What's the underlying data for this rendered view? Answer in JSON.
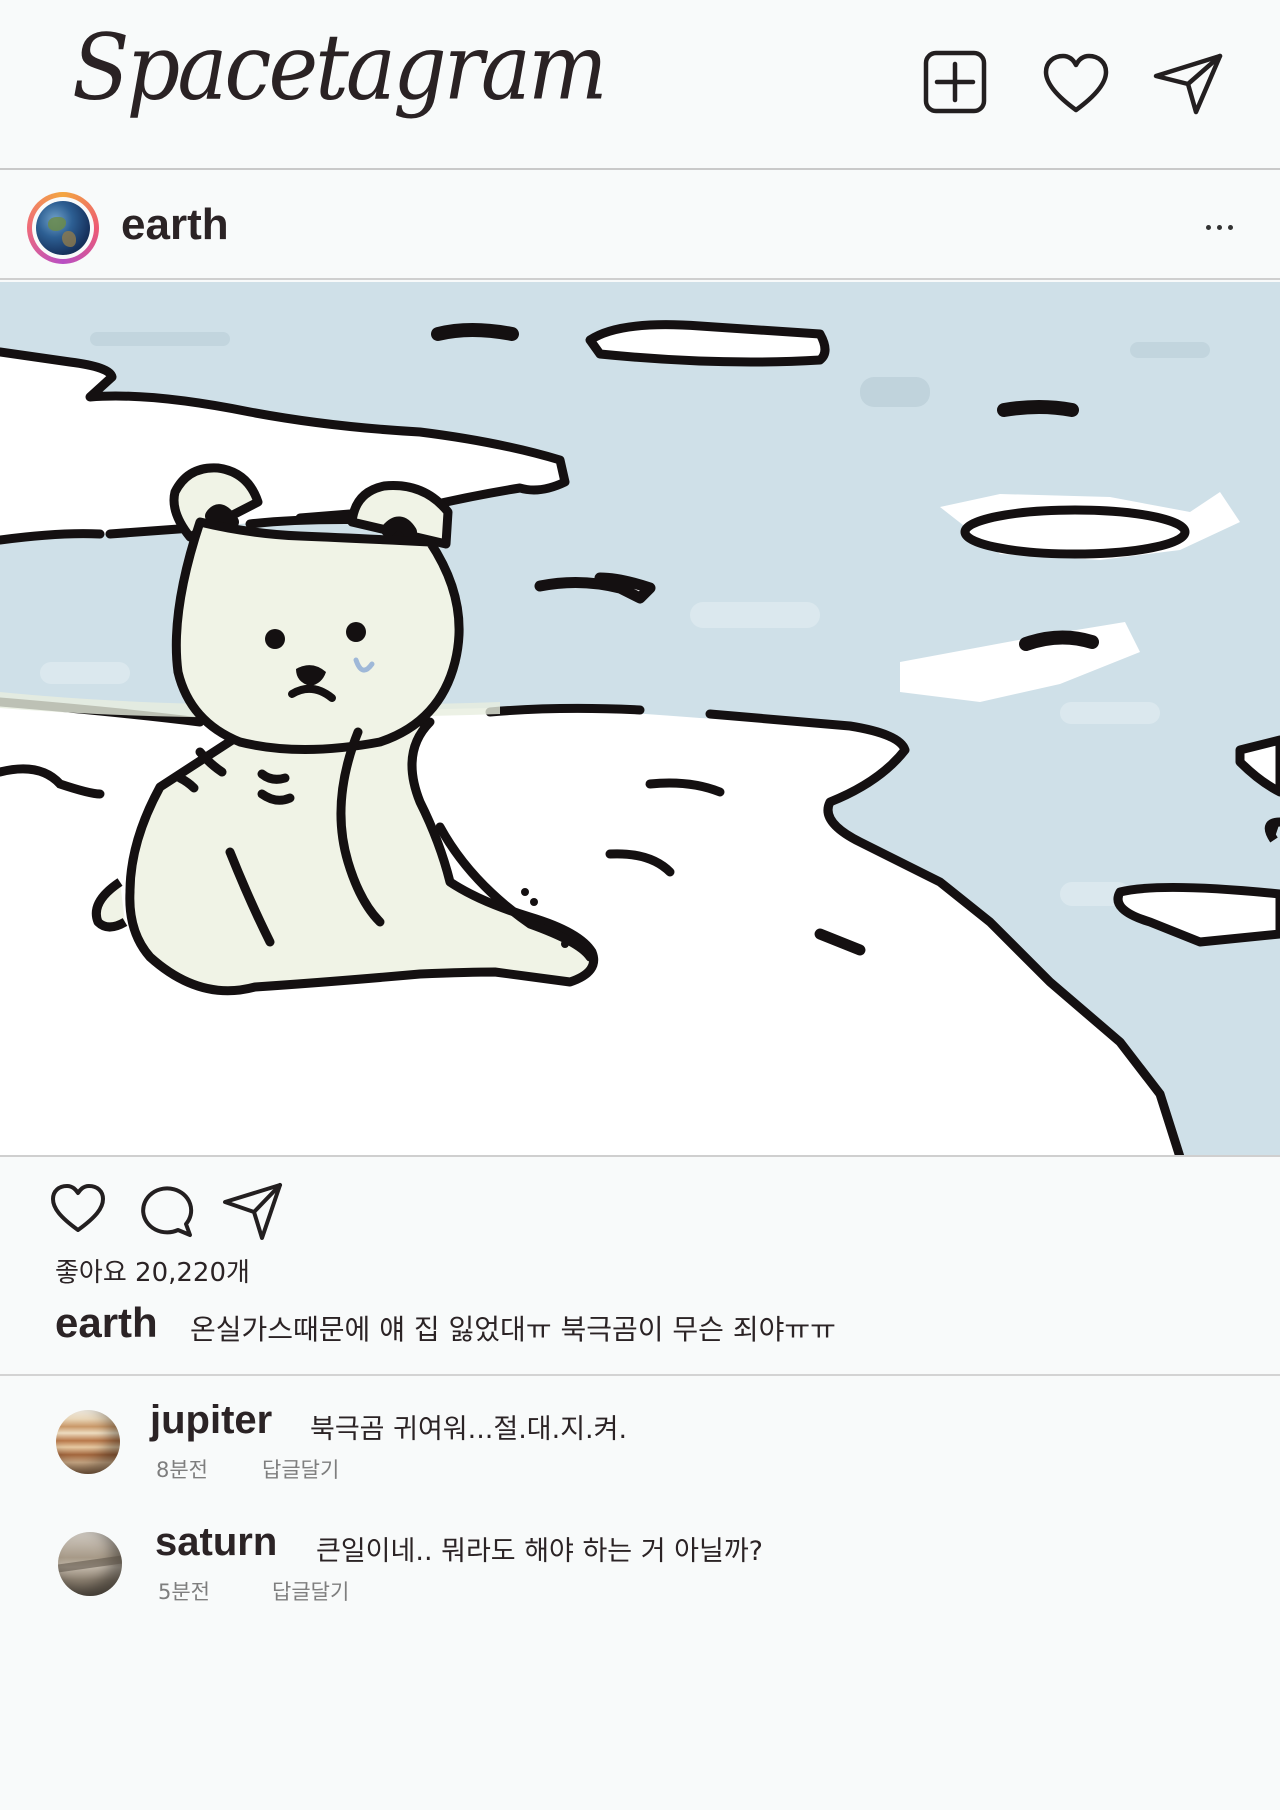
{
  "app": {
    "logo": "Spacetagram"
  },
  "header": {
    "icons": [
      "plus-square-icon",
      "heart-icon",
      "paper-plane-icon"
    ]
  },
  "post": {
    "username": "earth",
    "likes_text": "좋아요 20,220개",
    "caption_user": "earth",
    "caption_text": "온실가스때문에 얘 집 잃었대ㅠ 북극곰이 무슨 죄야ㅠㅠ",
    "actions": [
      "heart-icon",
      "comment-icon",
      "paper-plane-icon"
    ]
  },
  "comments": [
    {
      "username": "jupiter",
      "text": "북극곰 귀여워...절.대.지.켜.",
      "time": "8분전",
      "reply_label": "답글달기"
    },
    {
      "username": "saturn",
      "text": "큰일이네.. 뭐라도 해야 하는 거 아닐까?",
      "time": "5분전",
      "reply_label": "답글달기"
    }
  ],
  "colors": {
    "background": "#f8fafa",
    "water": "#cfe0e8",
    "ice": "#ffffff",
    "bear": "#f0f3e6",
    "outline": "#141011",
    "tear": "#9fb8d8"
  }
}
